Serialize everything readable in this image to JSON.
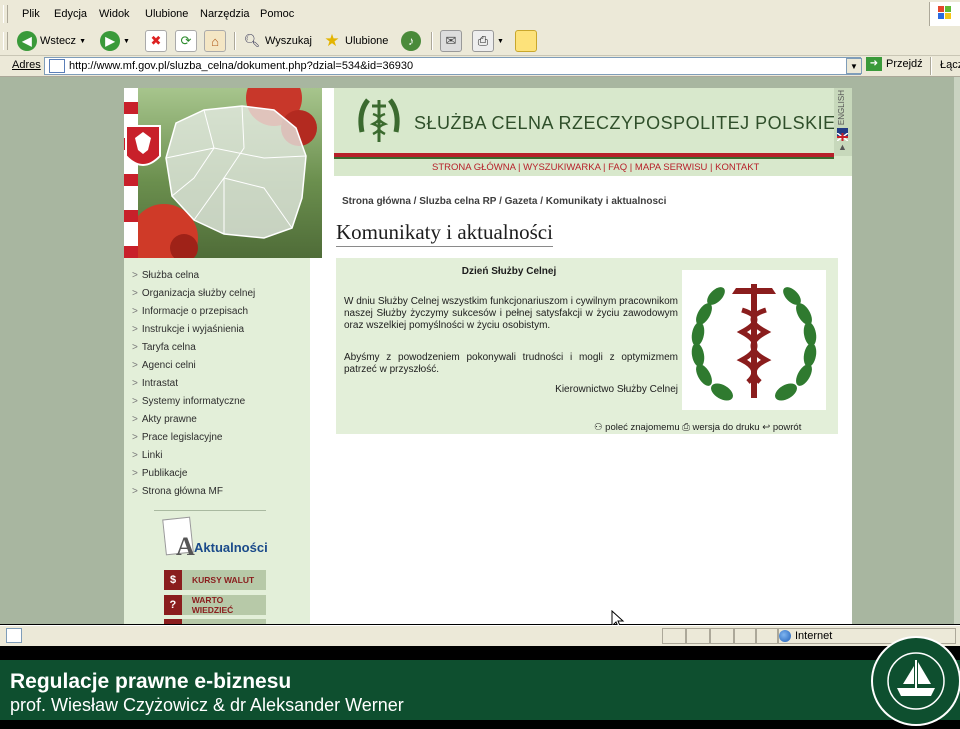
{
  "menubar": {
    "items": [
      "Plik",
      "Edycja",
      "Widok",
      "Ulubione",
      "Narzędzia",
      "Pomoc"
    ]
  },
  "toolbar": {
    "back": "Wstecz",
    "search": "Wyszukaj",
    "favorites": "Ulubione"
  },
  "addressbar": {
    "label": "Adres",
    "url": "http://www.mf.gov.pl/sluzba_celna/dokument.php?dzial=534&id=36930",
    "go": "Przejdź",
    "links": "Łącz"
  },
  "site": {
    "title": "SŁUŻBA CELNA RZECZYPOSPOLITEJ POLSKIEJ",
    "english": "ENGLISH",
    "nav": [
      "STRONA GŁÓWNA",
      "WYSZUKIWARKA",
      "FAQ",
      "MAPA SERWISU",
      "KONTAKT"
    ],
    "breadcrumb": "Strona główna / Sluzba celna RP / Gazeta / Komunikaty i aktualnosci",
    "heading": "Komunikaty i aktualności"
  },
  "sidebar": {
    "items": [
      "Służba celna",
      "Organizacja służby celnej",
      "Informacje o przepisach",
      "Instrukcje i wyjaśnienia",
      "Taryfa celna",
      "Agenci celni",
      "Intrastat",
      "Systemy informatyczne",
      "Akty prawne",
      "Prace legislacyjne",
      "Linki",
      "Publikacje",
      "Strona główna MF"
    ],
    "aktualnosci": "Aktualności",
    "buttons": [
      {
        "icon": "$",
        "label": "KURSY WALUT"
      },
      {
        "icon": "?",
        "label": "WARTO WIEDZIEĆ"
      }
    ]
  },
  "article": {
    "title": "Dzień Służby Celnej",
    "p1": "W dniu Służby Celnej wszystkim funkcjonariuszom i cywilnym pracownikom naszej Służby życzymy sukcesów i pełnej satysfakcji w życiu zawodowym oraz wszelkiej pomyślności w życiu osobistym.",
    "p2": "Abyśmy z powodzeniem pokonywali trudności i mogli z optymizmem patrzeć w przyszłość.",
    "signature": "Kierownictwo Służby Celnej",
    "actions": [
      "poleć znajomemu",
      "wersja do druku",
      "powrót"
    ]
  },
  "statusbar": {
    "zone": "Internet"
  },
  "slide": {
    "title": "Regulacje prawne e-biznesu",
    "authors": "prof. Wiesław Czyżowicz & dr Aleksander Werner"
  },
  "colors": {
    "footer": "#0e4f2f",
    "accent_red": "#b7202a",
    "site_green": "#2f4f2a"
  }
}
